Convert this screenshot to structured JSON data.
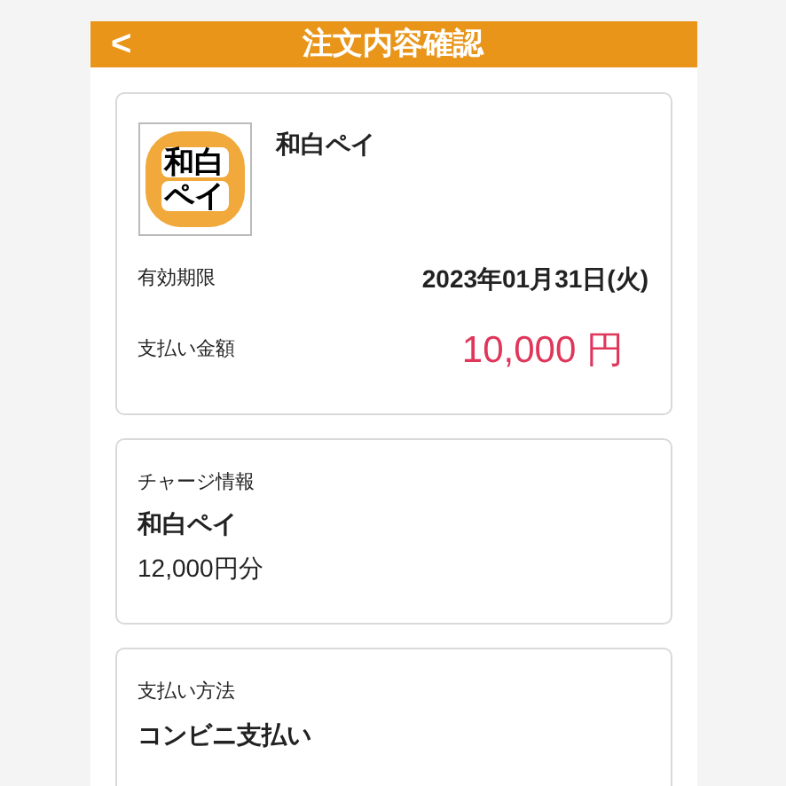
{
  "header": {
    "back": "<",
    "title": "注文内容確認"
  },
  "product": {
    "logo_lines": [
      "和白",
      "ペイ"
    ],
    "name": "和白ペイ",
    "rows": [
      {
        "kind": "date",
        "label": "有効期限",
        "value": "2023年01月31日(火)"
      },
      {
        "kind": "price",
        "label": "支払い金額",
        "value": "10,000 円"
      }
    ]
  },
  "charge": {
    "heading": "チャージ情報",
    "name": "和白ペイ",
    "amount": "12,000円分"
  },
  "payment": {
    "heading": "支払い方法",
    "method": "コンビニ支払い"
  }
}
